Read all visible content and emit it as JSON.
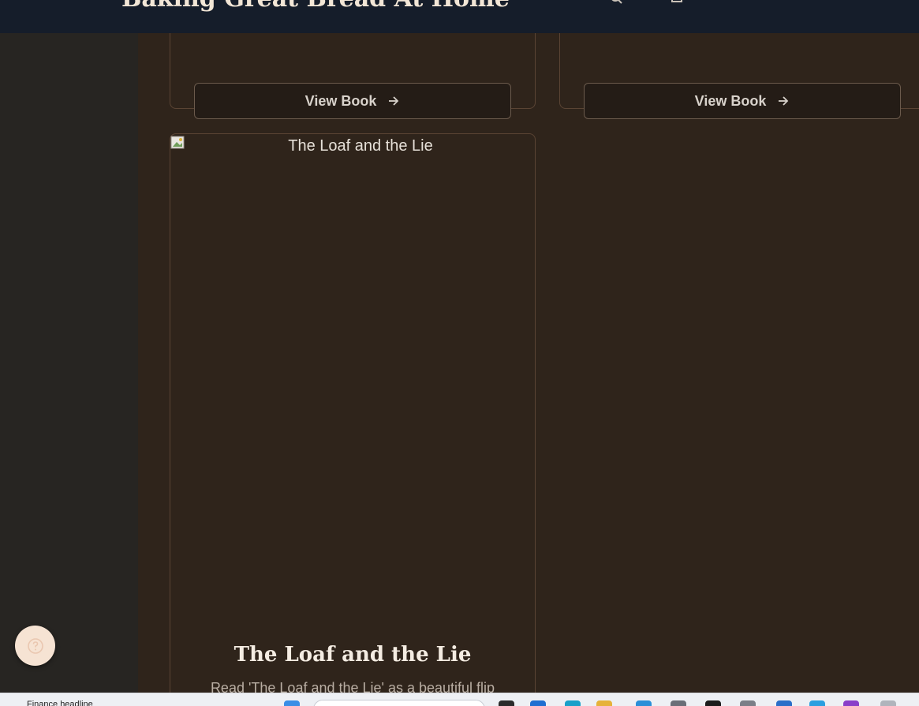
{
  "header": {
    "site_title": "Baking Great Bread At Home"
  },
  "cards": {
    "top_left": {
      "button_label": "View Book"
    },
    "top_right": {
      "button_label": "View Book"
    }
  },
  "book": {
    "cover_alt": "The Loaf and the Lie",
    "title": "The Loaf and the Lie",
    "description": "Read 'The Loaf and the Lie' as a beautiful flip"
  },
  "taskbar": {
    "news_text": "Finance headline"
  },
  "colors": {
    "nav_bg": "#151d2a",
    "page_bg": "#2f241b",
    "card_border": "#5a4434",
    "help_button_bg": "#f6e3d3"
  }
}
